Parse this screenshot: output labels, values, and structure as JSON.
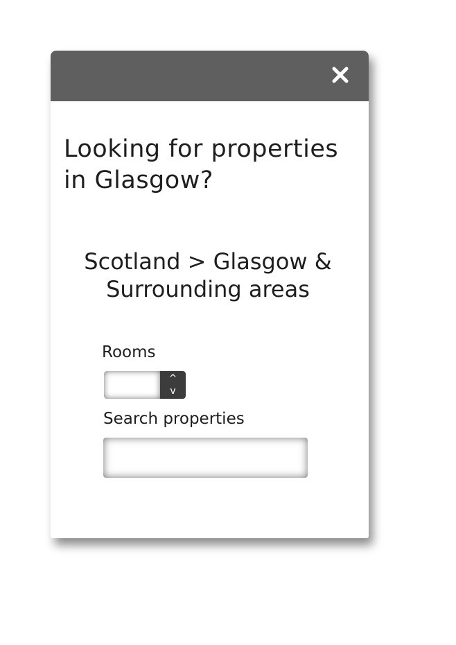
{
  "dialog": {
    "title": "Looking for properties in Glasgow?",
    "breadcrumb": "Scotland > Glasgow & Surrounding areas",
    "close_icon": "close-icon",
    "header_color": "#5f5f5f"
  },
  "rooms": {
    "label": "Rooms",
    "value": "",
    "increment_symbol": "^",
    "decrement_symbol": "v"
  },
  "search": {
    "label": "Search properties",
    "value": "",
    "placeholder": ""
  }
}
